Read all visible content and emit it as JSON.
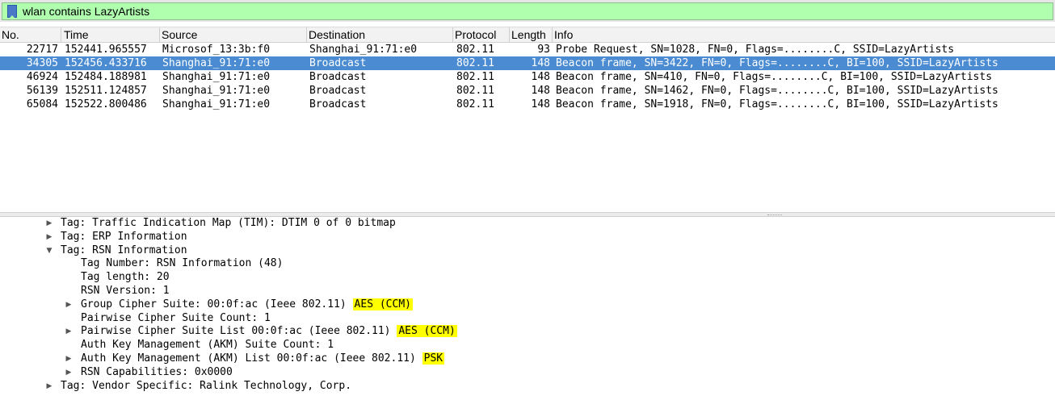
{
  "filter": {
    "text": "wlan contains LazyArtists"
  },
  "columns": {
    "no": "No.",
    "time": "Time",
    "source": "Source",
    "destination": "Destination",
    "protocol": "Protocol",
    "length": "Length",
    "info": "Info"
  },
  "packets": [
    {
      "no": "22717",
      "time": "152441.965557",
      "source": "Microsof_13:3b:f0",
      "destination": "Shanghai_91:71:e0",
      "protocol": "802.11",
      "length": "93",
      "info": "Probe Request, SN=1028, FN=0, Flags=........C, SSID=LazyArtists"
    },
    {
      "no": "34305",
      "time": "152456.433716",
      "source": "Shanghai_91:71:e0",
      "destination": "Broadcast",
      "protocol": "802.11",
      "length": "148",
      "info": "Beacon frame, SN=3422, FN=0, Flags=........C, BI=100, SSID=LazyArtists"
    },
    {
      "no": "46924",
      "time": "152484.188981",
      "source": "Shanghai_91:71:e0",
      "destination": "Broadcast",
      "protocol": "802.11",
      "length": "148",
      "info": "Beacon frame, SN=410, FN=0, Flags=........C, BI=100, SSID=LazyArtists"
    },
    {
      "no": "56139",
      "time": "152511.124857",
      "source": "Shanghai_91:71:e0",
      "destination": "Broadcast",
      "protocol": "802.11",
      "length": "148",
      "info": "Beacon frame, SN=1462, FN=0, Flags=........C, BI=100, SSID=LazyArtists"
    },
    {
      "no": "65084",
      "time": "152522.800486",
      "source": "Shanghai_91:71:e0",
      "destination": "Broadcast",
      "protocol": "802.11",
      "length": "148",
      "info": "Beacon frame, SN=1918, FN=0, Flags=........C, BI=100, SSID=LazyArtists"
    }
  ],
  "details": {
    "tim": "Tag: Traffic Indication Map (TIM): DTIM 0 of 0 bitmap",
    "erp": "Tag: ERP Information",
    "rsn": "Tag: RSN Information",
    "tag_number": "Tag Number: RSN Information (48)",
    "tag_length": "Tag length: 20",
    "rsn_version": "RSN Version: 1",
    "group_cipher": "Group Cipher Suite: 00:0f:ac (Ieee 802.11) ",
    "group_cipher_hl": "AES (CCM)",
    "pairwise_count": "Pairwise Cipher Suite Count: 1",
    "pairwise_list": "Pairwise Cipher Suite List 00:0f:ac (Ieee 802.11) ",
    "pairwise_list_hl": "AES (CCM)",
    "akm_count": "Auth Key Management (AKM) Suite Count: 1",
    "akm_list": "Auth Key Management (AKM) List 00:0f:ac (Ieee 802.11) ",
    "akm_list_hl": "PSK",
    "rsn_caps": "RSN Capabilities: 0x0000",
    "vendor": "Tag: Vendor Specific: Ralink Technology, Corp."
  },
  "colors": {
    "selected_row": "#4a8bd1",
    "filter_valid": "#afffaf",
    "highlight": "#ffff00"
  },
  "icons": {
    "bookmark": "bookmark-icon",
    "collapsed": "collapsed-arrow-icon",
    "expanded": "expanded-arrow-icon"
  }
}
